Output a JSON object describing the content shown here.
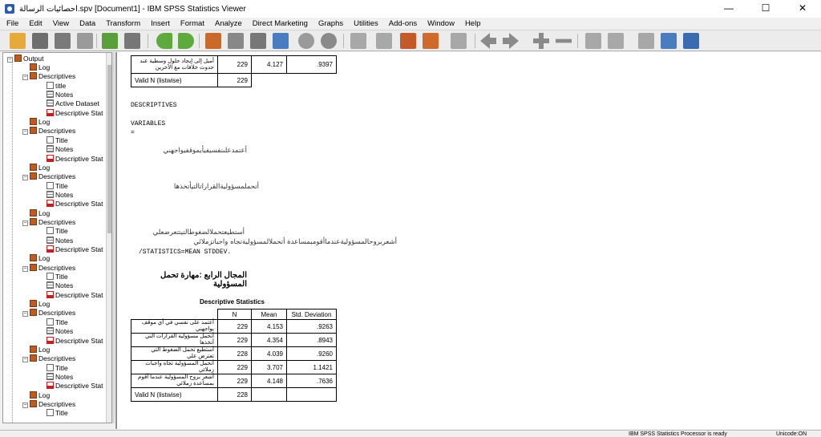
{
  "window": {
    "title": "احصائيات الرسالة.spv [Document1] - IBM SPSS Statistics Viewer",
    "minimize": "—",
    "maximize": "☐",
    "close": "✕"
  },
  "menu": [
    "File",
    "Edit",
    "View",
    "Data",
    "Transform",
    "Insert",
    "Format",
    "Analyze",
    "Direct Marketing",
    "Graphs",
    "Utilities",
    "Add-ons",
    "Window",
    "Help"
  ],
  "outline": {
    "root": "Output",
    "items": [
      {
        "label": "Log",
        "level": 1,
        "icon": "book"
      },
      {
        "label": "Descriptives",
        "level": 1,
        "icon": "book"
      },
      {
        "label": "title",
        "level": 2,
        "icon": "doc"
      },
      {
        "label": "Notes",
        "level": 2,
        "icon": "tbl"
      },
      {
        "label": "Active Dataset",
        "level": 2,
        "icon": "tbl"
      },
      {
        "label": "Descriptive Stat",
        "level": 2,
        "icon": "red"
      },
      {
        "label": "Log",
        "level": 1,
        "icon": "book"
      },
      {
        "label": "Descriptives",
        "level": 1,
        "icon": "book"
      },
      {
        "label": "Title",
        "level": 2,
        "icon": "doc"
      },
      {
        "label": "Notes",
        "level": 2,
        "icon": "tbl"
      },
      {
        "label": "Descriptive Stat",
        "level": 2,
        "icon": "red"
      },
      {
        "label": "Log",
        "level": 1,
        "icon": "book"
      },
      {
        "label": "Descriptives",
        "level": 1,
        "icon": "book"
      },
      {
        "label": "Title",
        "level": 2,
        "icon": "doc"
      },
      {
        "label": "Notes",
        "level": 2,
        "icon": "tbl"
      },
      {
        "label": "Descriptive Stat",
        "level": 2,
        "icon": "red"
      },
      {
        "label": "Log",
        "level": 1,
        "icon": "book"
      },
      {
        "label": "Descriptives",
        "level": 1,
        "icon": "book"
      },
      {
        "label": "Title",
        "level": 2,
        "icon": "doc"
      },
      {
        "label": "Notes",
        "level": 2,
        "icon": "tbl"
      },
      {
        "label": "Descriptive Stat",
        "level": 2,
        "icon": "red"
      },
      {
        "label": "Log",
        "level": 1,
        "icon": "book"
      },
      {
        "label": "Descriptives",
        "level": 1,
        "icon": "book"
      },
      {
        "label": "Title",
        "level": 2,
        "icon": "doc"
      },
      {
        "label": "Notes",
        "level": 2,
        "icon": "tbl"
      },
      {
        "label": "Descriptive Stat",
        "level": 2,
        "icon": "red"
      },
      {
        "label": "Log",
        "level": 1,
        "icon": "book"
      },
      {
        "label": "Descriptives",
        "level": 1,
        "icon": "book"
      },
      {
        "label": "Title",
        "level": 2,
        "icon": "doc"
      },
      {
        "label": "Notes",
        "level": 2,
        "icon": "tbl"
      },
      {
        "label": "Descriptive Stat",
        "level": 2,
        "icon": "red"
      },
      {
        "label": "Log",
        "level": 1,
        "icon": "book"
      },
      {
        "label": "Descriptives",
        "level": 1,
        "icon": "book"
      },
      {
        "label": "Title",
        "level": 2,
        "icon": "doc"
      },
      {
        "label": "Notes",
        "level": 2,
        "icon": "tbl"
      },
      {
        "label": "Descriptive Stat",
        "level": 2,
        "icon": "red"
      },
      {
        "label": "Log",
        "level": 1,
        "icon": "book"
      },
      {
        "label": "Descriptives",
        "level": 1,
        "icon": "book"
      },
      {
        "label": "Title",
        "level": 2,
        "icon": "doc"
      }
    ]
  },
  "prev_table": {
    "row_label": "أميل إلى إيجاد حلول وسطية عند حدوث خلافات مع الآخرين",
    "n": "229",
    "mean": "4.127",
    "sd": ".9397",
    "valid_label": "Valid N (listwise)",
    "valid_n": "229"
  },
  "syntax": {
    "line1": "DESCRIPTIVES",
    "line2": "VARIABLES",
    "line3": "=",
    "arabic1": "أعتمدعلىنفسيفيأيموقفيواجهني",
    "arabic2": "أتحملمسؤوليةالقراراتالتيأتخذها",
    "arabic3": "أستطيعتحملالضغوطالتيتتعرضعلي",
    "arabic4": "أشعربروحالمسؤوليةعندماأقومبمساعدة أتحملالمسؤوليةتجاه واجباتزملائي",
    "line_end": "/STATISTICS=MEAN STDDEV."
  },
  "section_heading": "المجال الرابع :مهارة تحمل المسؤولية",
  "table": {
    "caption": "Descriptive Statistics",
    "headers": [
      "N",
      "Mean",
      "Std. Deviation"
    ],
    "rows": [
      {
        "label": "أعتمد على نفسي في أي موقف يواجهني",
        "n": "229",
        "mean": "4.153",
        "sd": ".9263"
      },
      {
        "label": "أتحمل مسؤولية القرارات التي أتخذها",
        "n": "229",
        "mean": "4.354",
        "sd": ".8943"
      },
      {
        "label": "أستطيع تحمل الضغوط التي تعترض علي",
        "n": "228",
        "mean": "4.039",
        "sd": ".9260"
      },
      {
        "label": "أتحمل المسؤولية تجاه واجبات زملائي",
        "n": "229",
        "mean": "3.707",
        "sd": "1.1421"
      },
      {
        "label": "أشعر بروح المسؤولية عندما أقوم بمساعدة زملائي",
        "n": "229",
        "mean": "4.148",
        "sd": ".7636"
      }
    ],
    "valid_label": "Valid N (listwise)",
    "valid_n": "228"
  },
  "status": {
    "processor": "IBM SPSS Statistics Processor is ready",
    "unicode": "Unicode:ON"
  }
}
